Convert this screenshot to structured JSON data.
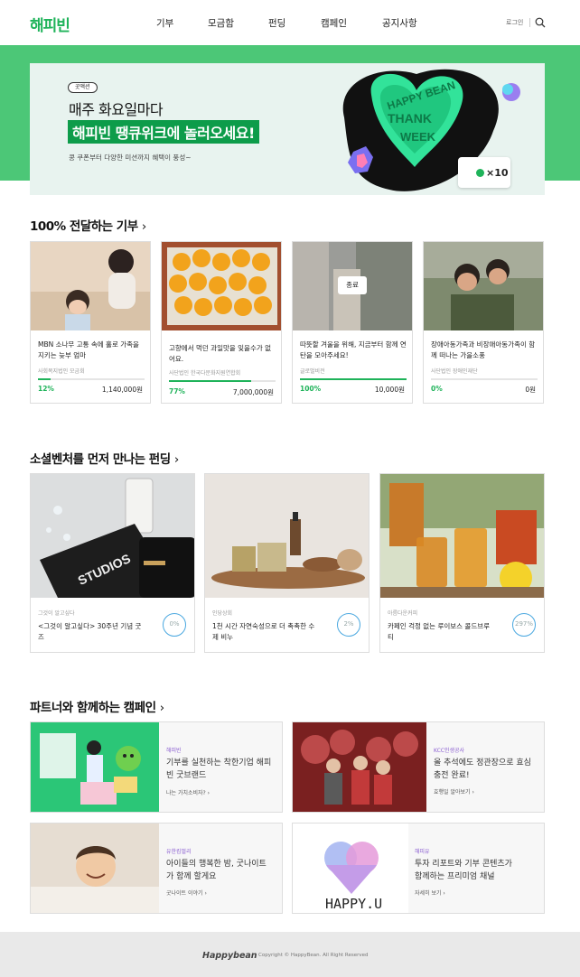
{
  "header": {
    "logo": "해피빈",
    "nav": [
      "기부",
      "모금함",
      "펀딩",
      "캠페인",
      "공지사항"
    ],
    "login": "로그인",
    "search_icon": "search-icon"
  },
  "hero": {
    "chip": "곳액션",
    "line1": "매주 화요일마다",
    "line2": "해피빈 땡큐위크에 놀러오세요!",
    "line3": "콩 쿠폰부터 다양한 미션까지 혜택이 풍성~",
    "badge": "×10",
    "art_text": "HAPPY BEAN THANK WEEK"
  },
  "donation": {
    "title": "100% 전달하는 기부",
    "ended_label": "종료",
    "cards": [
      {
        "title": "MBN 소나무 고통 속에 홀로 가족을 지키는 늦부 엄마",
        "org": "사회복지법인 모금회",
        "pct": "12%",
        "progress": 0.12,
        "amount": "1,140,000원"
      },
      {
        "title": "고향에서 먹던 과일맛을 잊을수가 없어요.",
        "org": "사단법인 한국다문화지원연합회",
        "pct": "77%",
        "progress": 0.77,
        "amount": "7,000,000원"
      },
      {
        "title": "따뜻할 겨울을 위해, 지금부터 함께 연탄을 모아주세요!",
        "org": "글로벌비전",
        "pct": "100%",
        "progress": 1.0,
        "amount": "10,000원"
      },
      {
        "title": "장애아동가족과 비장애아동가족이 함께 떠나는 가을소풍",
        "org": "사단법인 장애인재단",
        "pct": "0%",
        "progress": 0.0,
        "amount": "0원"
      }
    ]
  },
  "funding": {
    "title": "소셜벤처를 먼저 만나는 펀딩",
    "cards": [
      {
        "cat": "그것이 알고싶다",
        "title": "<그것이 알고싶다> 30주년 기념 굿즈",
        "pct": "0%"
      },
      {
        "cat": "인당상회",
        "title": "1천 시간 자연숙성으로 더 촉촉한 수제 비누",
        "pct": "2%"
      },
      {
        "cat": "아름다운커피",
        "title": "카페인 걱정 없는 루이보스 콜드브루티",
        "pct": "297%"
      }
    ]
  },
  "campaign": {
    "title": "파트너와 함께하는 캠페인",
    "cards": [
      {
        "cat": "해피빈",
        "title": "기부를 실천하는 착한기업 해피빈 굿브랜드",
        "link": "나는 가치소비자?"
      },
      {
        "cat": "KCC인생공사",
        "title": "올 추석에도 정관장으로 효심 충전 완료!",
        "link": "효행일 알아보기"
      },
      {
        "cat": "유한킴벌리",
        "title": "아이들의 행복한 밤, 굿나이트가 함께 할게요",
        "link": "굿나이트 이야기"
      },
      {
        "cat": "해피유",
        "title": "투자 리포트와 기부 콘텐츠가 함께하는 프리미엄 채널",
        "link": "자세히 보기",
        "image_text": "HAPPY.U"
      }
    ]
  },
  "footer": {
    "logo": "Happybean",
    "copyright": "Copyright © HappyBean. All Right Reserved"
  }
}
